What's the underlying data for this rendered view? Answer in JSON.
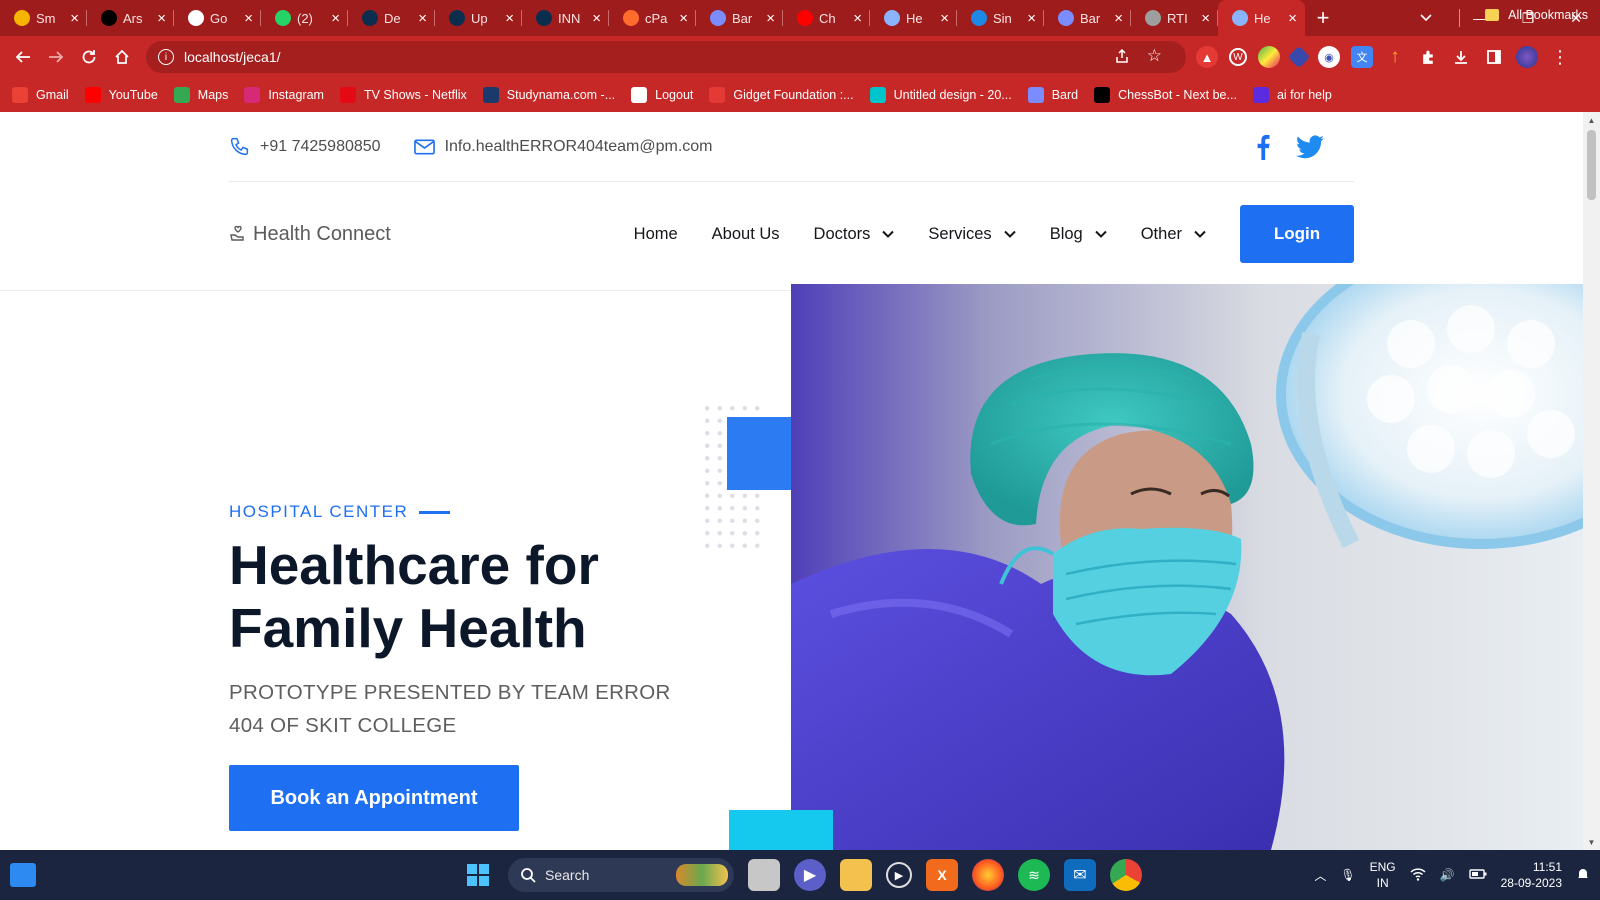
{
  "browser": {
    "tabs": [
      {
        "title": "Sm",
        "favicon": "maps-pin",
        "color": "#f4b400"
      },
      {
        "title": "Ars",
        "favicon": "x-logo",
        "color": "#000000"
      },
      {
        "title": "Go",
        "favicon": "google-g",
        "color": "#ffffff"
      },
      {
        "title": "(2)",
        "favicon": "whatsapp",
        "color": "#25d366"
      },
      {
        "title": "De",
        "favicon": "d-logo",
        "color": "#0b2e4f"
      },
      {
        "title": "Up",
        "favicon": "d-logo",
        "color": "#0b2e4f"
      },
      {
        "title": "INN",
        "favicon": "d-logo",
        "color": "#0b2e4f"
      },
      {
        "title": "cPa",
        "favicon": "cpanel",
        "color": "#ff6c2c"
      },
      {
        "title": "Bar",
        "favicon": "bard-sparkle",
        "color": "#7b8cff"
      },
      {
        "title": "Ch",
        "favicon": "youtube",
        "color": "#ff0000"
      },
      {
        "title": "He",
        "favicon": "health-logo",
        "color": "#8ab4ff"
      },
      {
        "title": "Sin",
        "favicon": "c-logo",
        "color": "#1e88e5"
      },
      {
        "title": "Bar",
        "favicon": "bard-sparkle",
        "color": "#7b8cff"
      },
      {
        "title": "RTI",
        "favicon": "globe",
        "color": "#9e9e9e"
      },
      {
        "title": "He",
        "favicon": "health-logo",
        "color": "#8ab4ff",
        "active": true
      }
    ],
    "url": "localhost/jeca1/",
    "bookmarks": [
      {
        "label": "Gmail",
        "icon": "gmail-icon",
        "color": "#ea4335"
      },
      {
        "label": "YouTube",
        "icon": "youtube-icon",
        "color": "#ff0000"
      },
      {
        "label": "Maps",
        "icon": "maps-icon",
        "color": "#34a853"
      },
      {
        "label": "Instagram",
        "icon": "instagram-icon",
        "color": "#d62976"
      },
      {
        "label": "TV Shows - Netflix",
        "icon": "netflix-icon",
        "color": "#e50914"
      },
      {
        "label": "Studynama.com -...",
        "icon": "studynama-icon",
        "color": "#1a3a6b"
      },
      {
        "label": "Logout",
        "icon": "globe-icon",
        "color": "#ffffff"
      },
      {
        "label": "Gidget Foundation :...",
        "icon": "gidget-icon",
        "color": "#e53935"
      },
      {
        "label": "Untitled design - 20...",
        "icon": "canva-icon",
        "color": "#00c4cc"
      },
      {
        "label": "Bard",
        "icon": "bard-icon",
        "color": "#7b8cff"
      },
      {
        "label": "ChessBot - Next be...",
        "icon": "chess-icon",
        "color": "#000000"
      },
      {
        "label": "ai for help",
        "icon": "c-icon",
        "color": "#5b2be0"
      }
    ],
    "all_bookmarks": "All Bookmarks",
    "extension_badge": "15"
  },
  "site": {
    "phone": "+91 7425980850",
    "email": "Info.healthERROR404team@pm.com",
    "brand": "Health Connect",
    "nav": [
      {
        "label": "Home",
        "dropdown": false
      },
      {
        "label": "About Us",
        "dropdown": false
      },
      {
        "label": "Doctors",
        "dropdown": true
      },
      {
        "label": "Services",
        "dropdown": true
      },
      {
        "label": "Blog",
        "dropdown": true
      },
      {
        "label": "Other",
        "dropdown": true
      }
    ],
    "login": "Login",
    "hero": {
      "eyebrow": "HOSPITAL CENTER",
      "headline_line1": "Healthcare for",
      "headline_line2": "Family Health",
      "subhead": "PROTOTYPE PRESENTED BY TEAM ERROR 404 OF SKIT COLLEGE",
      "cta": "Book an Appointment"
    },
    "colors": {
      "accent": "#1f6ff2",
      "heading": "#0c1829",
      "cyan": "#14c8ee"
    }
  },
  "taskbar": {
    "search_label": "Search",
    "lang_line1": "ENG",
    "lang_line2": "IN",
    "time": "11:51",
    "date": "28-09-2023"
  }
}
